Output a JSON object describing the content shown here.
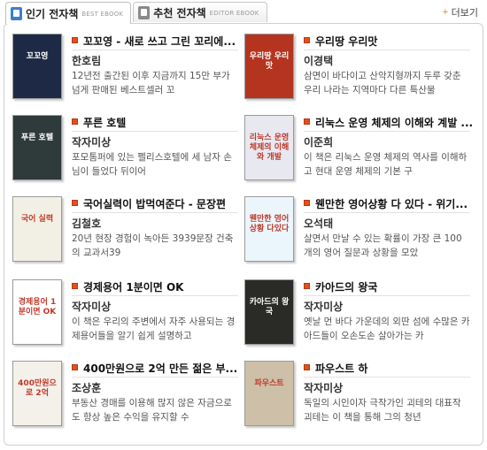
{
  "tabs": [
    {
      "label": "인기 전자책",
      "sub": "BEST EBOOK",
      "icon": "ebook-icon",
      "active": true
    },
    {
      "label": "추천 전자책",
      "sub": "EDITOR EBOOK",
      "icon": "ebook-icon",
      "active": false
    }
  ],
  "more_label": "더보기",
  "books": [
    {
      "title": "꼬꼬영 - 새로 쓰고 그린 꼬리에...",
      "author": "한호림",
      "desc": "12년전 출간된 이후 지금까지 15만 부가 넘게 판매된 베스트셀러 꼬",
      "cover_text": "꼬꼬영",
      "cover_color": "#1e2a45"
    },
    {
      "title": "우리땅 우리맛",
      "author": "이경택",
      "desc": "삼면이 바다이고 산악지형까지 두루 갖춘 우리 나라는 지역마다 다른 특산물",
      "cover_text": "우리땅 우리맛",
      "cover_color": "#b5341f"
    },
    {
      "title": "푸른 호텔",
      "author": "작자미상",
      "desc": "포모톰퍼에 있는 펠리스호텔에 세 남자 손님이 들었다 뒤이어",
      "cover_text": "푸른 호텔",
      "cover_color": "#2f3a3a"
    },
    {
      "title": "리눅스 운영 체제의 이해와 계발 ...",
      "author": "이준희",
      "desc": "이 책은 리눅스 운영 체제의 역사를 이해하고 현대 운영 체제의 기본 구",
      "cover_text": "리눅스 운영체제의 이해와 개발",
      "cover_color": "#e8e8f0"
    },
    {
      "title": "국어실력이 밥먹여준다 - 문장편",
      "author": "김철호",
      "desc": "20년 현장 경험이 녹아든 3939문장 건축의 교과서39",
      "cover_text": "국어 실력",
      "cover_color": "#f2f0e4"
    },
    {
      "title": "웬만한 영어상황 다 있다 - 위기...",
      "author": "오석태",
      "desc": "살면서 만날 수 있는 확률이 가장 큰 100개의 영어 질문과 상황을 모았",
      "cover_text": "웬만한 영어상황 다있다",
      "cover_color": "#eaf6fb"
    },
    {
      "title": "경제용어 1분이면 OK",
      "author": "작자미상",
      "desc": "이 책은 우리의 주변에서 자주 사용되는 경제용어들을 알기 쉽게 설명하고",
      "cover_text": "경제용어 1분이면 OK",
      "cover_color": "#ffffff"
    },
    {
      "title": "카아드의 왕국",
      "author": "작자미상",
      "desc": "옛날 먼 바다 가운데의 외딴 섬에 수많은 카아드들이 오손도손 살아가는 카",
      "cover_text": "카아드의 왕국",
      "cover_color": "#2a2a26"
    },
    {
      "title": "400만원으로 2억 만든 젊은 부...",
      "author": "조상훈",
      "desc": "부동산 경매를 이용해 많지 않은 자금으로도 항상 높은 수익을 유지할 수",
      "cover_text": "400만원으로 2억",
      "cover_color": "#f4f0ea"
    },
    {
      "title": "파우스트 하",
      "author": "작자미상",
      "desc": "독일의 시인이자 극작가인 괴테의 대표작 괴테는 이 책을 통해 그의 청년",
      "cover_text": "파우스트",
      "cover_color": "#cdbfa8"
    }
  ],
  "colors": {
    "bullet": "#e2501c",
    "accent": "#3a7fd0",
    "more_arrow": "#e07b1a"
  }
}
